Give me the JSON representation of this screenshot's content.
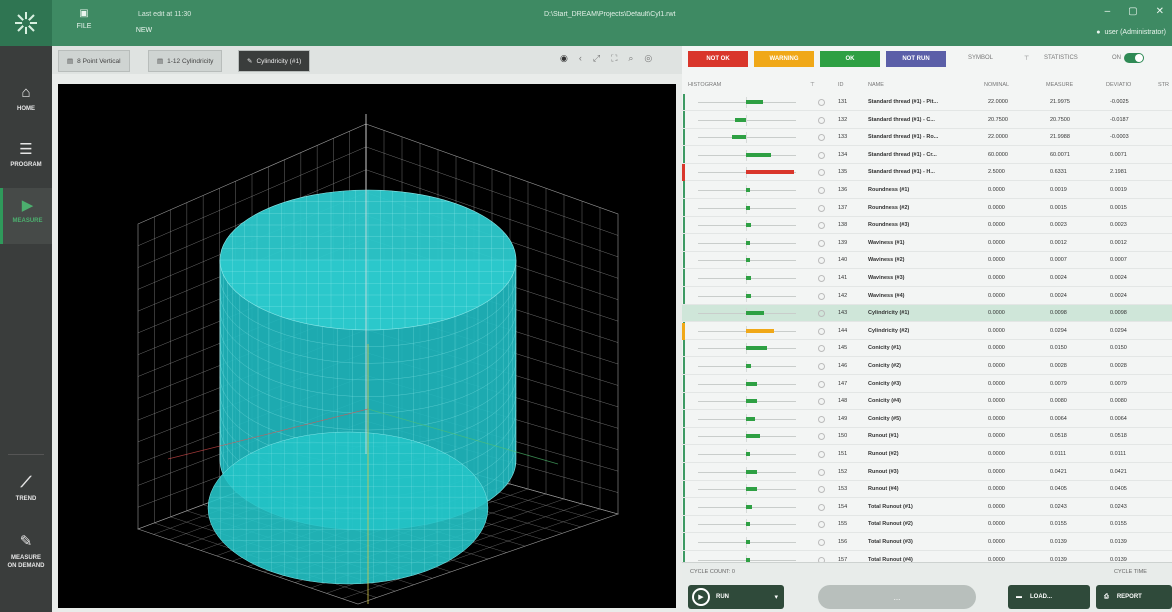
{
  "titlebar": {
    "file_label": "FILE",
    "new_label": "NEW",
    "last_saved": "Last edit at 11:30",
    "file_path": "D:\\Start_DREAM\\Projects\\Default\\Cyl1.rwt",
    "user": "user (Administrator)",
    "colors": {
      "bar": "#3e8a63",
      "logo_bg": "#2f7552"
    }
  },
  "nav": [
    {
      "label": "HOME",
      "icon": "home-icon"
    },
    {
      "label": "PROGRAM",
      "icon": "list-icon"
    },
    {
      "label": "MEASURE",
      "icon": "play-icon",
      "active": true
    },
    {
      "label": "TREND",
      "icon": "trend-icon"
    },
    {
      "label": "MEASURE ON DEMAND",
      "icon": "wand-icon"
    }
  ],
  "tabs": [
    {
      "label": "8 Point Vertical",
      "icon": "doc-icon"
    },
    {
      "label": "1-12 Cylindricity",
      "icon": "doc-icon"
    },
    {
      "label": "Cylindricity (#1)",
      "icon": "doc-icon",
      "active": true
    }
  ],
  "status_buttons": [
    {
      "label": "NOT OK",
      "color": "#d9362b"
    },
    {
      "label": "WARNING",
      "color": "#f0a818"
    },
    {
      "label": "OK",
      "color": "#2ea043"
    },
    {
      "label": "NOT RUN",
      "color": "#5b5fa8"
    }
  ],
  "panel_labels": {
    "symbol": "SYMBOL",
    "statistics": "STATISTICS",
    "toggle": "ON"
  },
  "table": {
    "headers": {
      "histogram": "HISTOGRAM",
      "id": "ID",
      "name": "NAME",
      "nominal": "NOMINAL",
      "measure": "MEASURE",
      "deviation": "DEVIATIO",
      "extra": "STR"
    },
    "rows": [
      {
        "id": "131",
        "name": "Standard thread (#1) - Pit...",
        "nominal": "22.0000",
        "measure": "21.9975",
        "dev": "-0.0025",
        "bar": 0.3,
        "color": "#2ea043"
      },
      {
        "id": "132",
        "name": "Standard thread (#1) - C...",
        "nominal": "20.7500",
        "measure": "20.7500",
        "dev": "-0.0187",
        "bar": 0.2,
        "color": "#2ea043",
        "neg": true
      },
      {
        "id": "133",
        "name": "Standard thread (#1) - Ro...",
        "nominal": "22.0000",
        "measure": "21.9988",
        "dev": "-0.0003",
        "bar": 0.25,
        "color": "#2ea043",
        "neg": true
      },
      {
        "id": "134",
        "name": "Standard thread (#1) - Cr...",
        "nominal": "60.0000",
        "measure": "60.0071",
        "dev": "0.0071",
        "bar": 0.45,
        "color": "#2ea043"
      },
      {
        "id": "135",
        "name": "Standard thread (#1) - H...",
        "nominal": "2.5000",
        "measure": "0.6331",
        "dev": "2.1981",
        "bar": 0.85,
        "color": "#d9362b",
        "status": "#d9362b"
      },
      {
        "id": "136",
        "name": "Roundness (#1)",
        "nominal": "0.0000",
        "measure": "0.0019",
        "dev": "0.0019",
        "bar": 0.08,
        "color": "#2ea043"
      },
      {
        "id": "137",
        "name": "Roundness (#2)",
        "nominal": "0.0000",
        "measure": "0.0015",
        "dev": "0.0015",
        "bar": 0.07,
        "color": "#2ea043"
      },
      {
        "id": "138",
        "name": "Roundness (#3)",
        "nominal": "0.0000",
        "measure": "0.0023",
        "dev": "0.0023",
        "bar": 0.09,
        "color": "#2ea043"
      },
      {
        "id": "139",
        "name": "Waviness (#1)",
        "nominal": "0.0000",
        "measure": "0.0012",
        "dev": "0.0012",
        "bar": 0.06,
        "color": "#2ea043"
      },
      {
        "id": "140",
        "name": "Waviness (#2)",
        "nominal": "0.0000",
        "measure": "0.0007",
        "dev": "0.0007",
        "bar": 0.04,
        "color": "#2ea043"
      },
      {
        "id": "141",
        "name": "Waviness (#3)",
        "nominal": "0.0000",
        "measure": "0.0024",
        "dev": "0.0024",
        "bar": 0.09,
        "color": "#2ea043"
      },
      {
        "id": "142",
        "name": "Waviness (#4)",
        "nominal": "0.0000",
        "measure": "0.0024",
        "dev": "0.0024",
        "bar": 0.09,
        "color": "#2ea043"
      },
      {
        "id": "143",
        "name": "Cylindricity (#1)",
        "nominal": "0.0000",
        "measure": "0.0098",
        "dev": "0.0098",
        "bar": 0.32,
        "color": "#2ea043",
        "selected": true
      },
      {
        "id": "144",
        "name": "Cylindricity (#2)",
        "nominal": "0.0000",
        "measure": "0.0294",
        "dev": "0.0294",
        "bar": 0.5,
        "color": "#f0a818",
        "status": "#f0a818"
      },
      {
        "id": "145",
        "name": "Conicity (#1)",
        "nominal": "0.0000",
        "measure": "0.0150",
        "dev": "0.0150",
        "bar": 0.38,
        "color": "#2ea043"
      },
      {
        "id": "146",
        "name": "Conicity (#2)",
        "nominal": "0.0000",
        "measure": "0.0028",
        "dev": "0.0028",
        "bar": 0.09,
        "color": "#2ea043"
      },
      {
        "id": "147",
        "name": "Conicity (#3)",
        "nominal": "0.0000",
        "measure": "0.0079",
        "dev": "0.0079",
        "bar": 0.2,
        "color": "#2ea043"
      },
      {
        "id": "148",
        "name": "Conicity (#4)",
        "nominal": "0.0000",
        "measure": "0.0080",
        "dev": "0.0080",
        "bar": 0.2,
        "color": "#2ea043"
      },
      {
        "id": "149",
        "name": "Conicity (#5)",
        "nominal": "0.0000",
        "measure": "0.0064",
        "dev": "0.0064",
        "bar": 0.16,
        "color": "#2ea043"
      },
      {
        "id": "150",
        "name": "Runout (#1)",
        "nominal": "0.0000",
        "measure": "0.0518",
        "dev": "0.0518",
        "bar": 0.25,
        "color": "#2ea043"
      },
      {
        "id": "151",
        "name": "Runout (#2)",
        "nominal": "0.0000",
        "measure": "0.0111",
        "dev": "0.0111",
        "bar": 0.06,
        "color": "#2ea043"
      },
      {
        "id": "152",
        "name": "Runout (#3)",
        "nominal": "0.0000",
        "measure": "0.0421",
        "dev": "0.0421",
        "bar": 0.2,
        "color": "#2ea043"
      },
      {
        "id": "153",
        "name": "Runout (#4)",
        "nominal": "0.0000",
        "measure": "0.0405",
        "dev": "0.0405",
        "bar": 0.2,
        "color": "#2ea043"
      },
      {
        "id": "154",
        "name": "Total Runout (#1)",
        "nominal": "0.0000",
        "measure": "0.0243",
        "dev": "0.0243",
        "bar": 0.1,
        "color": "#2ea043"
      },
      {
        "id": "155",
        "name": "Total Runout (#2)",
        "nominal": "0.0000",
        "measure": "0.0155",
        "dev": "0.0155",
        "bar": 0.07,
        "color": "#2ea043"
      },
      {
        "id": "156",
        "name": "Total Runout (#3)",
        "nominal": "0.0000",
        "measure": "0.0139",
        "dev": "0.0139",
        "bar": 0.07,
        "color": "#2ea043"
      },
      {
        "id": "157",
        "name": "Total Runout (#4)",
        "nominal": "0.0000",
        "measure": "0.0139",
        "dev": "0.0139",
        "bar": 0.07,
        "color": "#2ea043"
      }
    ]
  },
  "bottom": {
    "cycle_count": "CYCLE COUNT: 0",
    "cycle_time": "CYCLE TIME",
    "run_label": "RUN",
    "grey_label": "...",
    "load_label": "LOAD...",
    "report_label": "REPORT"
  }
}
